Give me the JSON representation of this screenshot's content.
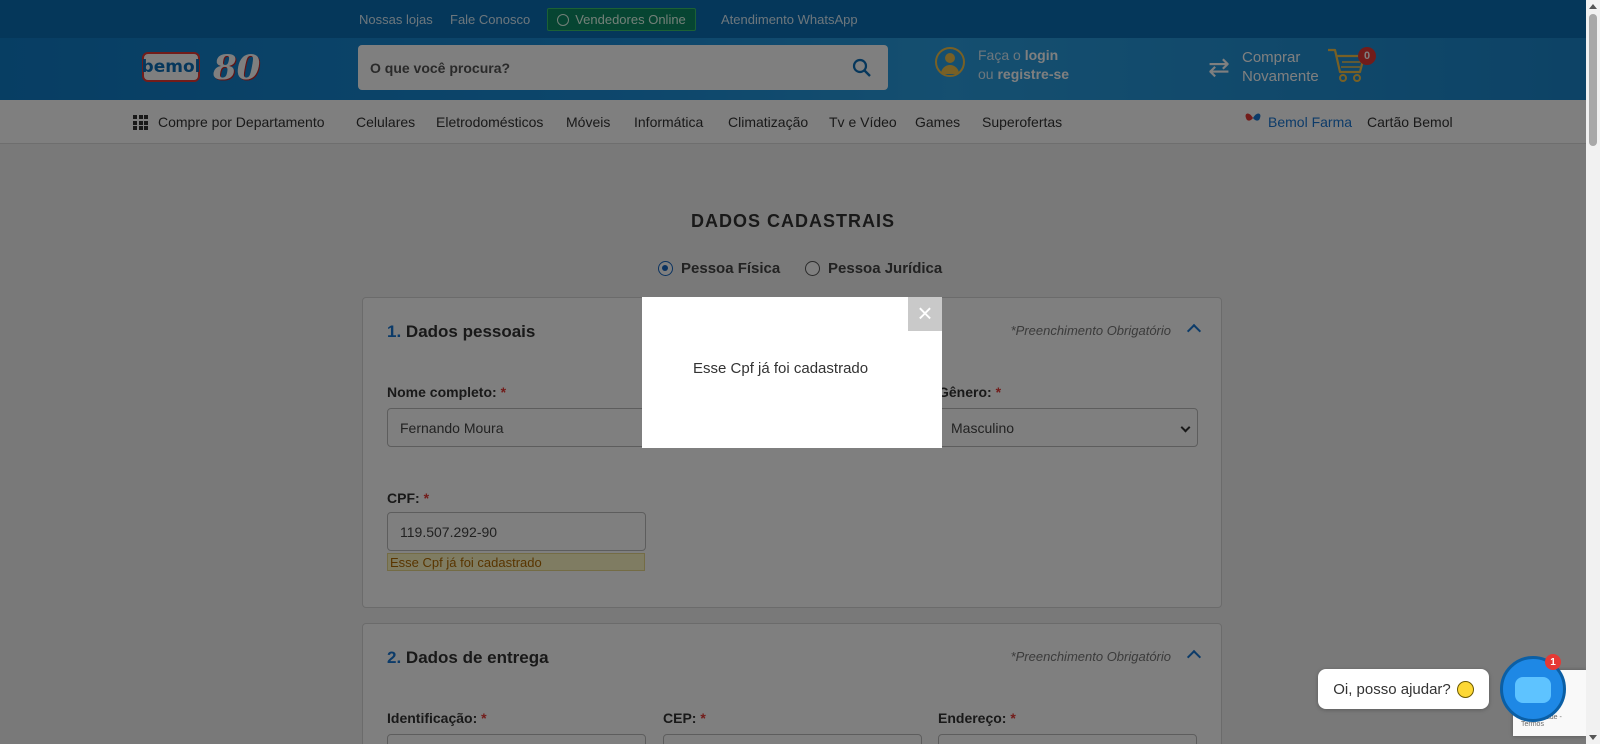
{
  "topbar": {
    "links": [
      "Nossas lojas",
      "Fale Conosco"
    ],
    "vendedores": "Vendedores Online",
    "whatsapp": "Atendimento WhatsApp"
  },
  "header": {
    "logo_text": "bemol",
    "logo_80": "80",
    "search_placeholder": "O que você procura?",
    "login_line1_prefix": "Faça o ",
    "login_line1_link": "login",
    "login_line2_prefix": "ou ",
    "login_line2_link": "registre-se",
    "rebuy_line1": "Comprar",
    "rebuy_line2": "Novamente",
    "cart_count": "0"
  },
  "nav": {
    "departments": "Compre por Departamento",
    "items": [
      "Celulares",
      "Eletrodomésticos",
      "Móveis",
      "Informática",
      "Climatização",
      "Tv e Vídeo",
      "Games",
      "Superofertas"
    ],
    "farma": "Bemol Farma",
    "cartao": "Cartão Bemol"
  },
  "main": {
    "title": "DADOS CADASTRAIS",
    "person_types": [
      "Pessoa Física",
      "Pessoa Jurídica"
    ],
    "section1": {
      "number": "1.",
      "title": "Dados pessoais",
      "required_note": "*Preenchimento Obrigatório",
      "name_label": "Nome completo:",
      "name_value": "Fernando Moura",
      "gender_label": "Gênero:",
      "gender_value": "Masculino",
      "cpf_label": "CPF:",
      "cpf_value": "119.507.292-90",
      "cpf_error": "Esse Cpf já foi cadastrado",
      "required_mark": "*"
    },
    "section2": {
      "number": "2.",
      "title": "Dados de entrega",
      "required_note": "*Preenchimento Obrigatório",
      "id_label": "Identificação:",
      "cep_label": "CEP:",
      "address_label": "Endereço:"
    }
  },
  "modal": {
    "message": "Esse Cpf já foi cadastrado",
    "close": "×"
  },
  "chat": {
    "bubble": "Oi, posso ajudar?",
    "badge": "1"
  },
  "recaptcha": {
    "text": "Privacidade - Termos"
  },
  "colors": {
    "topbar": "#0a6fb5",
    "accent": "#1976d2",
    "required": "#e53935"
  }
}
